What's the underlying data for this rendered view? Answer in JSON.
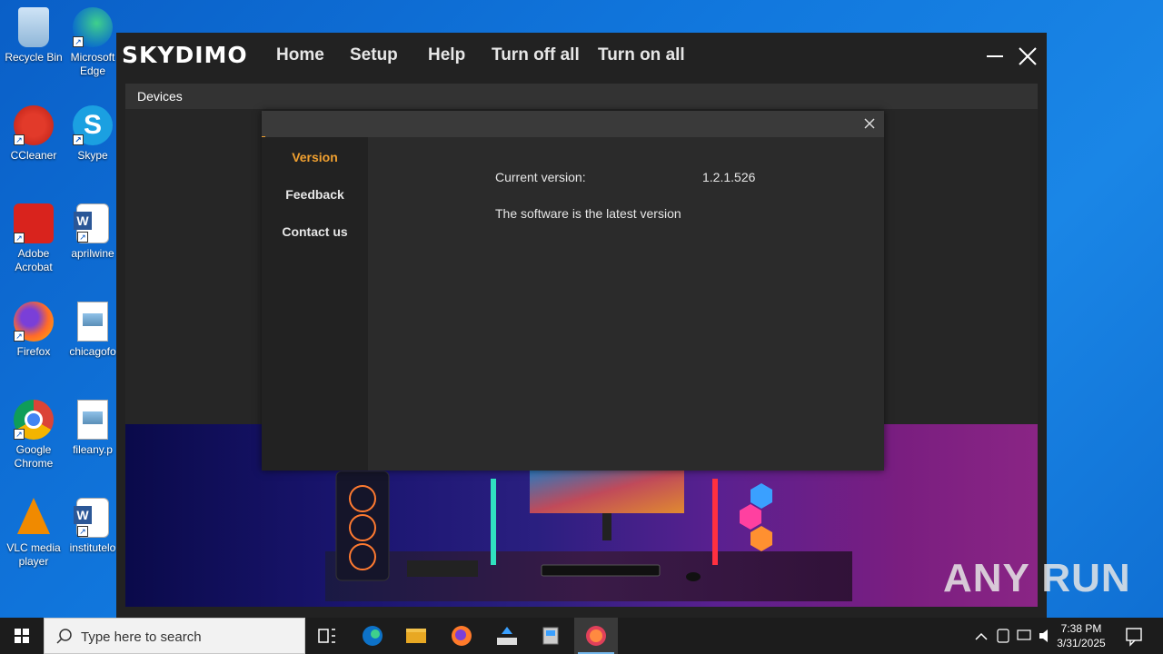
{
  "desktop": {
    "icons": [
      {
        "label": "Recycle Bin"
      },
      {
        "label": "Microsoft Edge"
      },
      {
        "label": "CCleaner"
      },
      {
        "label": "Skype"
      },
      {
        "label": "Adobe Acrobat"
      },
      {
        "label": "aprilwine"
      },
      {
        "label": "Firefox"
      },
      {
        "label": "chicagofo"
      },
      {
        "label": "Google Chrome"
      },
      {
        "label": "fileany.p"
      },
      {
        "label": "VLC media player"
      },
      {
        "label": "institutelo"
      }
    ]
  },
  "app": {
    "brand": "SKYDIMO",
    "nav": {
      "home": "Home",
      "setup": "Setup",
      "help": "Help",
      "turn_off_all": "Turn off all",
      "turn_on_all": "Turn on all"
    },
    "devices_label": "Devices"
  },
  "dialog": {
    "sidebar": {
      "version": "Version",
      "feedback": "Feedback",
      "contact": "Contact us"
    },
    "current_version_label": "Current version:",
    "current_version_value": "1.2.1.526",
    "status": "The software is the latest version",
    "accent_color": "#f0a030"
  },
  "taskbar": {
    "search_placeholder": "Type here to search",
    "time": "7:38 PM",
    "date": "3/31/2025"
  },
  "watermark": "ANY RUN"
}
